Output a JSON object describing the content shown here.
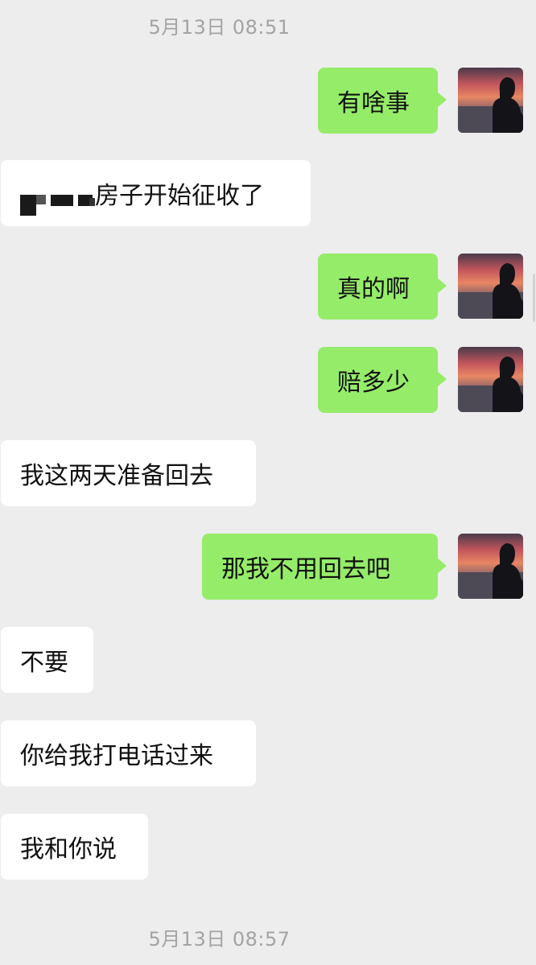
{
  "timestamps": {
    "top": "5月13日 08:51",
    "bottom": "5月13日 08:57"
  },
  "messages": [
    {
      "from": "me",
      "text": "有啥事"
    },
    {
      "from": "other",
      "text": "房子开始征收了"
    },
    {
      "from": "me",
      "text": "真的啊"
    },
    {
      "from": "me",
      "text": "赔多少"
    },
    {
      "from": "other",
      "text": "我这两天准备回去"
    },
    {
      "from": "me",
      "text": "那我不用回去吧"
    },
    {
      "from": "other",
      "text": "不要"
    },
    {
      "from": "other",
      "text": "你给我打电话过来"
    },
    {
      "from": "other",
      "text": "我和你说"
    }
  ],
  "colors": {
    "background": "#ededed",
    "outgoing_bubble": "#95ec69",
    "incoming_bubble": "#ffffff",
    "timestamp_text": "#a3a3a3"
  },
  "avatar_icon": "sunset-silhouette-avatar"
}
